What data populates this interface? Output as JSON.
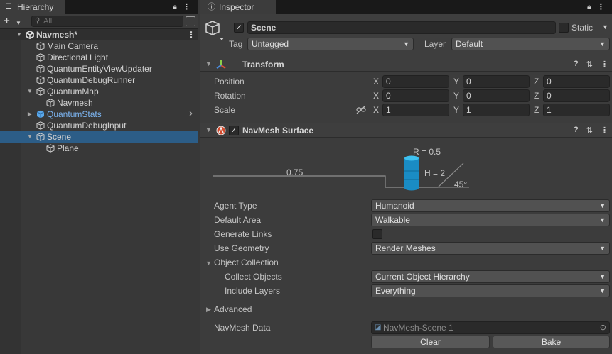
{
  "hierarchy": {
    "tab_label": "Hierarchy",
    "search_placeholder": "All",
    "add_label": "+",
    "items": [
      {
        "label": "Navmesh*",
        "depth": 0,
        "fold": "open",
        "icon": "unity-scene-icon",
        "root": true
      },
      {
        "label": "Main Camera",
        "depth": 1,
        "fold": "none",
        "icon": "gameobject-icon"
      },
      {
        "label": "Directional Light",
        "depth": 1,
        "fold": "none",
        "icon": "gameobject-icon"
      },
      {
        "label": "QuantumEntityViewUpdater",
        "depth": 1,
        "fold": "none",
        "icon": "gameobject-icon"
      },
      {
        "label": "QuantumDebugRunner",
        "depth": 1,
        "fold": "none",
        "icon": "gameobject-icon"
      },
      {
        "label": "QuantumMap",
        "depth": 1,
        "fold": "open",
        "icon": "gameobject-icon"
      },
      {
        "label": "Navmesh",
        "depth": 2,
        "fold": "none",
        "icon": "gameobject-icon"
      },
      {
        "label": "QuantumStats",
        "depth": 1,
        "fold": "closed",
        "icon": "prefab-icon",
        "blue": true,
        "chevron": true
      },
      {
        "label": "QuantumDebugInput",
        "depth": 1,
        "fold": "none",
        "icon": "gameobject-icon"
      },
      {
        "label": "Scene",
        "depth": 1,
        "fold": "open",
        "icon": "gameobject-icon",
        "selected": true
      },
      {
        "label": "Plane",
        "depth": 2,
        "fold": "none",
        "icon": "gameobject-icon"
      }
    ]
  },
  "inspector": {
    "tab_label": "Inspector",
    "object_name": "Scene",
    "static_label": "Static",
    "tag_label": "Tag",
    "tag_value": "Untagged",
    "layer_label": "Layer",
    "layer_value": "Default",
    "transform": {
      "title": "Transform",
      "position_label": "Position",
      "rotation_label": "Rotation",
      "scale_label": "Scale",
      "position": [
        "0",
        "0",
        "0"
      ],
      "rotation": [
        "0",
        "0",
        "0"
      ],
      "scale": [
        "1",
        "1",
        "1"
      ],
      "axis_labels": [
        "X",
        "Y",
        "Z"
      ]
    },
    "navmesh_surface": {
      "title": "NavMesh Surface",
      "diagram": {
        "radius_label": "R = 0.5",
        "height_label": "H = 2",
        "step_label": "0.75",
        "slope_label": "45°",
        "agent_color": "#1ea0d8"
      },
      "agent_type_label": "Agent Type",
      "agent_type_value": "Humanoid",
      "default_area_label": "Default Area",
      "default_area_value": "Walkable",
      "generate_links_label": "Generate Links",
      "use_geometry_label": "Use Geometry",
      "use_geometry_value": "Render Meshes",
      "object_collection_label": "Object Collection",
      "collect_objects_label": "Collect Objects",
      "collect_objects_value": "Current Object Hierarchy",
      "include_layers_label": "Include Layers",
      "include_layers_value": "Everything",
      "advanced_label": "Advanced",
      "navmesh_data_label": "NavMesh Data",
      "navmesh_data_value": "NavMesh-Scene 1",
      "clear_label": "Clear",
      "bake_label": "Bake"
    }
  }
}
